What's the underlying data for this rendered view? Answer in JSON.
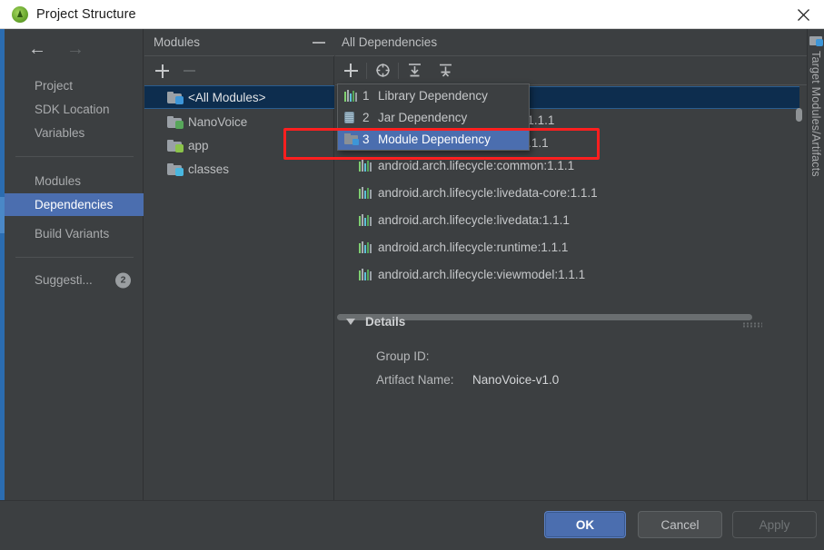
{
  "window": {
    "title": "Project Structure",
    "app_icon": "android-studio-icon",
    "close_icon": "close-icon"
  },
  "sidebar": {
    "back_icon": "arrow-left-icon",
    "forward_icon": "arrow-right-icon",
    "items": [
      {
        "label": "Project",
        "selected": false,
        "badge": ""
      },
      {
        "label": "SDK Location",
        "selected": false,
        "badge": ""
      },
      {
        "label": "Variables",
        "selected": false,
        "badge": ""
      },
      {
        "label": "Modules",
        "selected": false,
        "badge": ""
      },
      {
        "label": "Dependencies",
        "selected": true,
        "badge": ""
      },
      {
        "label": "Build Variants",
        "selected": false,
        "badge": ""
      },
      {
        "label": "Suggesti...",
        "selected": false,
        "badge": "2"
      }
    ]
  },
  "modules_panel": {
    "title": "Modules",
    "collapse_icon": "minimize-icon",
    "add_icon": "plus-icon",
    "remove_icon": "minus-icon",
    "items": [
      {
        "label": "<All Modules>",
        "icon": "all-modules-icon",
        "selected": true
      },
      {
        "label": "NanoVoice",
        "icon": "module-icon",
        "selected": false
      },
      {
        "label": "app",
        "icon": "app-module-icon",
        "selected": false
      },
      {
        "label": "classes",
        "icon": "classes-icon",
        "selected": false
      }
    ]
  },
  "dependencies_panel": {
    "title": "All Dependencies",
    "toolbar": [
      {
        "name": "add-dependency-button",
        "icon": "plus-icon"
      },
      {
        "name": "show-scope-button",
        "icon": "target-icon"
      },
      {
        "name": "expand-all-button",
        "icon": "expand-all-icon"
      },
      {
        "name": "collapse-all-button",
        "icon": "collapse-all-icon"
      }
    ],
    "rows": [
      {
        "label": "",
        "selected": true,
        "icon": "library-icon",
        "obscured": true
      },
      {
        "label": "android.arch.core:common:1.1.1",
        "selected": false,
        "icon": "library-icon",
        "obscured": true
      },
      {
        "label": "android.arch.core:runtime:1.1.1",
        "selected": false,
        "icon": "library-icon",
        "obscured": true
      },
      {
        "label": "android.arch.lifecycle:common:1.1.1",
        "selected": false,
        "icon": "library-icon",
        "obscured": false
      },
      {
        "label": "android.arch.lifecycle:livedata-core:1.1.1",
        "selected": false,
        "icon": "library-icon",
        "obscured": false
      },
      {
        "label": "android.arch.lifecycle:livedata:1.1.1",
        "selected": false,
        "icon": "library-icon",
        "obscured": false
      },
      {
        "label": "android.arch.lifecycle:runtime:1.1.1",
        "selected": false,
        "icon": "library-icon",
        "obscured": false
      },
      {
        "label": "android.arch.lifecycle:viewmodel:1.1.1",
        "selected": false,
        "icon": "library-icon",
        "obscured": false
      }
    ]
  },
  "popup_menu": {
    "items": [
      {
        "number": "1",
        "label": "Library Dependency",
        "icon": "library-icon",
        "highlighted": false
      },
      {
        "number": "2",
        "label": "Jar Dependency",
        "icon": "jar-icon",
        "highlighted": false
      },
      {
        "number": "3",
        "label": "Module Dependency",
        "icon": "module-icon",
        "highlighted": true
      }
    ]
  },
  "details": {
    "title": "Details",
    "expand_icon": "triangle-down-icon",
    "fields": [
      {
        "label": "Group ID:",
        "value": ""
      },
      {
        "label": "Artifact Name:",
        "value": "NanoVoice-v1.0"
      }
    ]
  },
  "right_tab": {
    "label": "Target Modules/Artifacts",
    "icon": "module-icon"
  },
  "footer": {
    "ok_label": "OK",
    "cancel_label": "Cancel",
    "apply_label": "Apply"
  },
  "annotation": {
    "type": "red-rectangle-highlight",
    "color": "#ff1f1f"
  }
}
